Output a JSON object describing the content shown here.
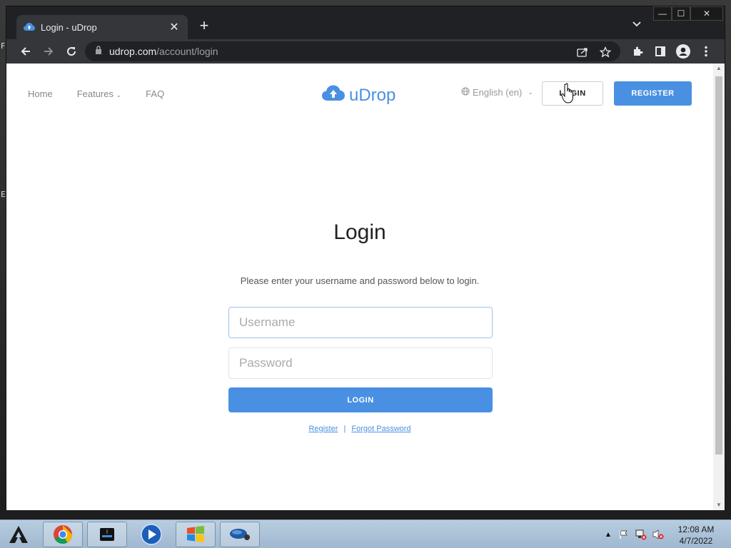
{
  "desktop": {
    "label_top": "F",
    "label_mid": "E"
  },
  "browser": {
    "tab": {
      "title": "Login - uDrop",
      "close": "✕"
    },
    "new_tab": "+",
    "window_controls": {
      "minimize": "—",
      "maximize": "☐",
      "close": "✕"
    },
    "url": {
      "domain": "udrop.com",
      "path": "/account/login"
    }
  },
  "site": {
    "nav": [
      {
        "label": "Home"
      },
      {
        "label": "Features"
      },
      {
        "label": "FAQ"
      }
    ],
    "features_caret": "⌄",
    "logo": "uDrop",
    "language": "English (en)",
    "language_caret": "⌄",
    "login_button": "LOGIN",
    "register_button": "REGISTER",
    "colors": {
      "accent": "#4a90e2"
    }
  },
  "login": {
    "title": "Login",
    "subtitle": "Please enter your username and password below to login.",
    "username_placeholder": "Username",
    "password_placeholder": "Password",
    "submit": "LOGIN",
    "register_link": "Register",
    "separator": "|",
    "forgot_link": "Forgot Password"
  },
  "taskbar": {
    "apps": [
      "start-icon",
      "chrome-icon",
      "drive-icon",
      "media-player-icon",
      "windows-explorer-icon",
      "network-tool-icon"
    ],
    "clock_time": "12:08 AM",
    "clock_date": "4/7/2022"
  }
}
